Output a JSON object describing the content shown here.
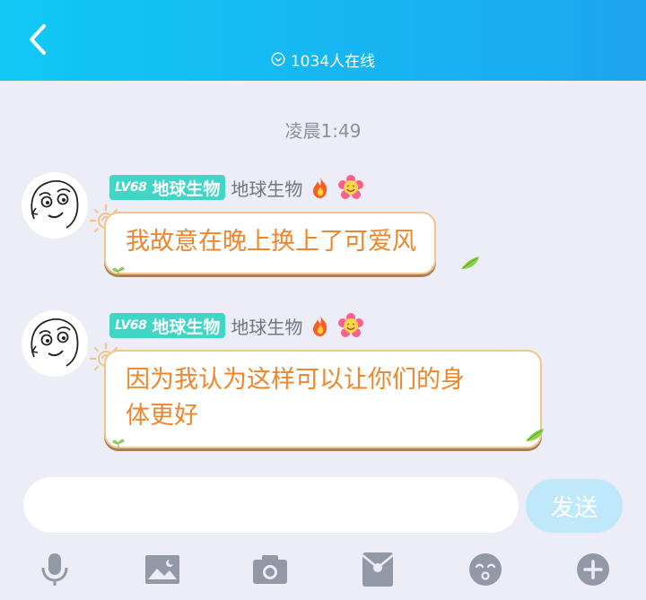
{
  "header": {
    "online_text": "1034人在线",
    "colors": {
      "gradient_start": "#11c8f5",
      "gradient_end": "#1ea5f0"
    }
  },
  "chat": {
    "timestamp": "凌晨1:49",
    "messages": [
      {
        "level": "LV68",
        "title": "地球生物",
        "nickname": "地球生物",
        "badges": [
          "fire-icon",
          "flower-smile-icon"
        ],
        "text": "我故意在晚上换上了可爱风"
      },
      {
        "level": "LV68",
        "title": "地球生物",
        "nickname": "地球生物",
        "badges": [
          "fire-icon",
          "flower-smile-icon"
        ],
        "text_lines": [
          "因为我认为这样可以让你们的身",
          "体更好"
        ]
      }
    ]
  },
  "composer": {
    "input_value": "",
    "send_label": "发送"
  },
  "toolbar": {
    "items": [
      "microphone-icon",
      "image-icon",
      "camera-icon",
      "red-packet-icon",
      "emoji-icon",
      "plus-icon"
    ]
  }
}
